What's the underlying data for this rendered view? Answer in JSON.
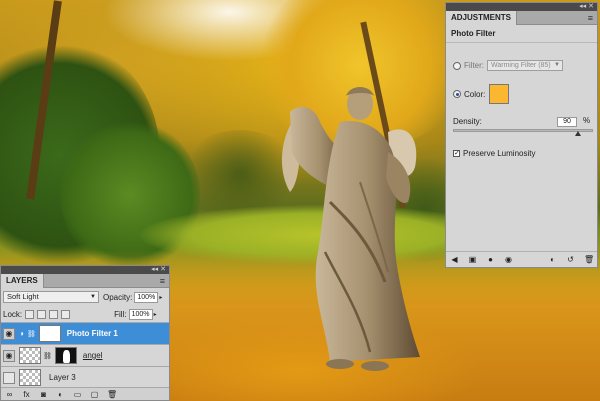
{
  "adjustments": {
    "tab_label": "ADJUSTMENTS",
    "title": "Photo Filter",
    "filter_label": "Filter:",
    "filter_value": "Warming Filter (85)",
    "color_label": "Color:",
    "color_swatch": "#fbb730",
    "density_label": "Density:",
    "density_value": "90",
    "density_unit": "%",
    "density_fraction": 0.9,
    "preserve_label": "Preserve Luminosity",
    "preserve_checked": true
  },
  "layers": {
    "tab_label": "LAYERS",
    "blend_mode": "Soft Light",
    "opacity_label": "Opacity:",
    "opacity_value": "100%",
    "lock_label": "Lock:",
    "fill_label": "Fill:",
    "fill_value": "100%",
    "items": [
      {
        "name": "Photo Filter 1",
        "selected": true
      },
      {
        "name": "angel",
        "selected": false
      },
      {
        "name": "Layer 3",
        "selected": false
      }
    ]
  },
  "colors": {
    "selection": "#3d8ed6",
    "panel_bg": "#d6d6d6",
    "panel_header": "#4a4a4a"
  }
}
